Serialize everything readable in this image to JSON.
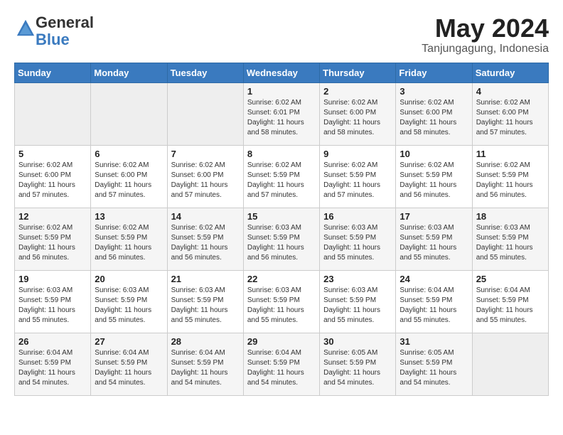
{
  "logo": {
    "general": "General",
    "blue": "Blue"
  },
  "header": {
    "month": "May 2024",
    "location": "Tanjungagung, Indonesia"
  },
  "weekdays": [
    "Sunday",
    "Monday",
    "Tuesday",
    "Wednesday",
    "Thursday",
    "Friday",
    "Saturday"
  ],
  "weeks": [
    [
      {
        "day": "",
        "info": ""
      },
      {
        "day": "",
        "info": ""
      },
      {
        "day": "",
        "info": ""
      },
      {
        "day": "1",
        "info": "Sunrise: 6:02 AM\nSunset: 6:01 PM\nDaylight: 11 hours\nand 58 minutes."
      },
      {
        "day": "2",
        "info": "Sunrise: 6:02 AM\nSunset: 6:00 PM\nDaylight: 11 hours\nand 58 minutes."
      },
      {
        "day": "3",
        "info": "Sunrise: 6:02 AM\nSunset: 6:00 PM\nDaylight: 11 hours\nand 58 minutes."
      },
      {
        "day": "4",
        "info": "Sunrise: 6:02 AM\nSunset: 6:00 PM\nDaylight: 11 hours\nand 57 minutes."
      }
    ],
    [
      {
        "day": "5",
        "info": "Sunrise: 6:02 AM\nSunset: 6:00 PM\nDaylight: 11 hours\nand 57 minutes."
      },
      {
        "day": "6",
        "info": "Sunrise: 6:02 AM\nSunset: 6:00 PM\nDaylight: 11 hours\nand 57 minutes."
      },
      {
        "day": "7",
        "info": "Sunrise: 6:02 AM\nSunset: 6:00 PM\nDaylight: 11 hours\nand 57 minutes."
      },
      {
        "day": "8",
        "info": "Sunrise: 6:02 AM\nSunset: 5:59 PM\nDaylight: 11 hours\nand 57 minutes."
      },
      {
        "day": "9",
        "info": "Sunrise: 6:02 AM\nSunset: 5:59 PM\nDaylight: 11 hours\nand 57 minutes."
      },
      {
        "day": "10",
        "info": "Sunrise: 6:02 AM\nSunset: 5:59 PM\nDaylight: 11 hours\nand 56 minutes."
      },
      {
        "day": "11",
        "info": "Sunrise: 6:02 AM\nSunset: 5:59 PM\nDaylight: 11 hours\nand 56 minutes."
      }
    ],
    [
      {
        "day": "12",
        "info": "Sunrise: 6:02 AM\nSunset: 5:59 PM\nDaylight: 11 hours\nand 56 minutes."
      },
      {
        "day": "13",
        "info": "Sunrise: 6:02 AM\nSunset: 5:59 PM\nDaylight: 11 hours\nand 56 minutes."
      },
      {
        "day": "14",
        "info": "Sunrise: 6:02 AM\nSunset: 5:59 PM\nDaylight: 11 hours\nand 56 minutes."
      },
      {
        "day": "15",
        "info": "Sunrise: 6:03 AM\nSunset: 5:59 PM\nDaylight: 11 hours\nand 56 minutes."
      },
      {
        "day": "16",
        "info": "Sunrise: 6:03 AM\nSunset: 5:59 PM\nDaylight: 11 hours\nand 55 minutes."
      },
      {
        "day": "17",
        "info": "Sunrise: 6:03 AM\nSunset: 5:59 PM\nDaylight: 11 hours\nand 55 minutes."
      },
      {
        "day": "18",
        "info": "Sunrise: 6:03 AM\nSunset: 5:59 PM\nDaylight: 11 hours\nand 55 minutes."
      }
    ],
    [
      {
        "day": "19",
        "info": "Sunrise: 6:03 AM\nSunset: 5:59 PM\nDaylight: 11 hours\nand 55 minutes."
      },
      {
        "day": "20",
        "info": "Sunrise: 6:03 AM\nSunset: 5:59 PM\nDaylight: 11 hours\nand 55 minutes."
      },
      {
        "day": "21",
        "info": "Sunrise: 6:03 AM\nSunset: 5:59 PM\nDaylight: 11 hours\nand 55 minutes."
      },
      {
        "day": "22",
        "info": "Sunrise: 6:03 AM\nSunset: 5:59 PM\nDaylight: 11 hours\nand 55 minutes."
      },
      {
        "day": "23",
        "info": "Sunrise: 6:03 AM\nSunset: 5:59 PM\nDaylight: 11 hours\nand 55 minutes."
      },
      {
        "day": "24",
        "info": "Sunrise: 6:04 AM\nSunset: 5:59 PM\nDaylight: 11 hours\nand 55 minutes."
      },
      {
        "day": "25",
        "info": "Sunrise: 6:04 AM\nSunset: 5:59 PM\nDaylight: 11 hours\nand 55 minutes."
      }
    ],
    [
      {
        "day": "26",
        "info": "Sunrise: 6:04 AM\nSunset: 5:59 PM\nDaylight: 11 hours\nand 54 minutes."
      },
      {
        "day": "27",
        "info": "Sunrise: 6:04 AM\nSunset: 5:59 PM\nDaylight: 11 hours\nand 54 minutes."
      },
      {
        "day": "28",
        "info": "Sunrise: 6:04 AM\nSunset: 5:59 PM\nDaylight: 11 hours\nand 54 minutes."
      },
      {
        "day": "29",
        "info": "Sunrise: 6:04 AM\nSunset: 5:59 PM\nDaylight: 11 hours\nand 54 minutes."
      },
      {
        "day": "30",
        "info": "Sunrise: 6:05 AM\nSunset: 5:59 PM\nDaylight: 11 hours\nand 54 minutes."
      },
      {
        "day": "31",
        "info": "Sunrise: 6:05 AM\nSunset: 5:59 PM\nDaylight: 11 hours\nand 54 minutes."
      },
      {
        "day": "",
        "info": ""
      }
    ]
  ]
}
